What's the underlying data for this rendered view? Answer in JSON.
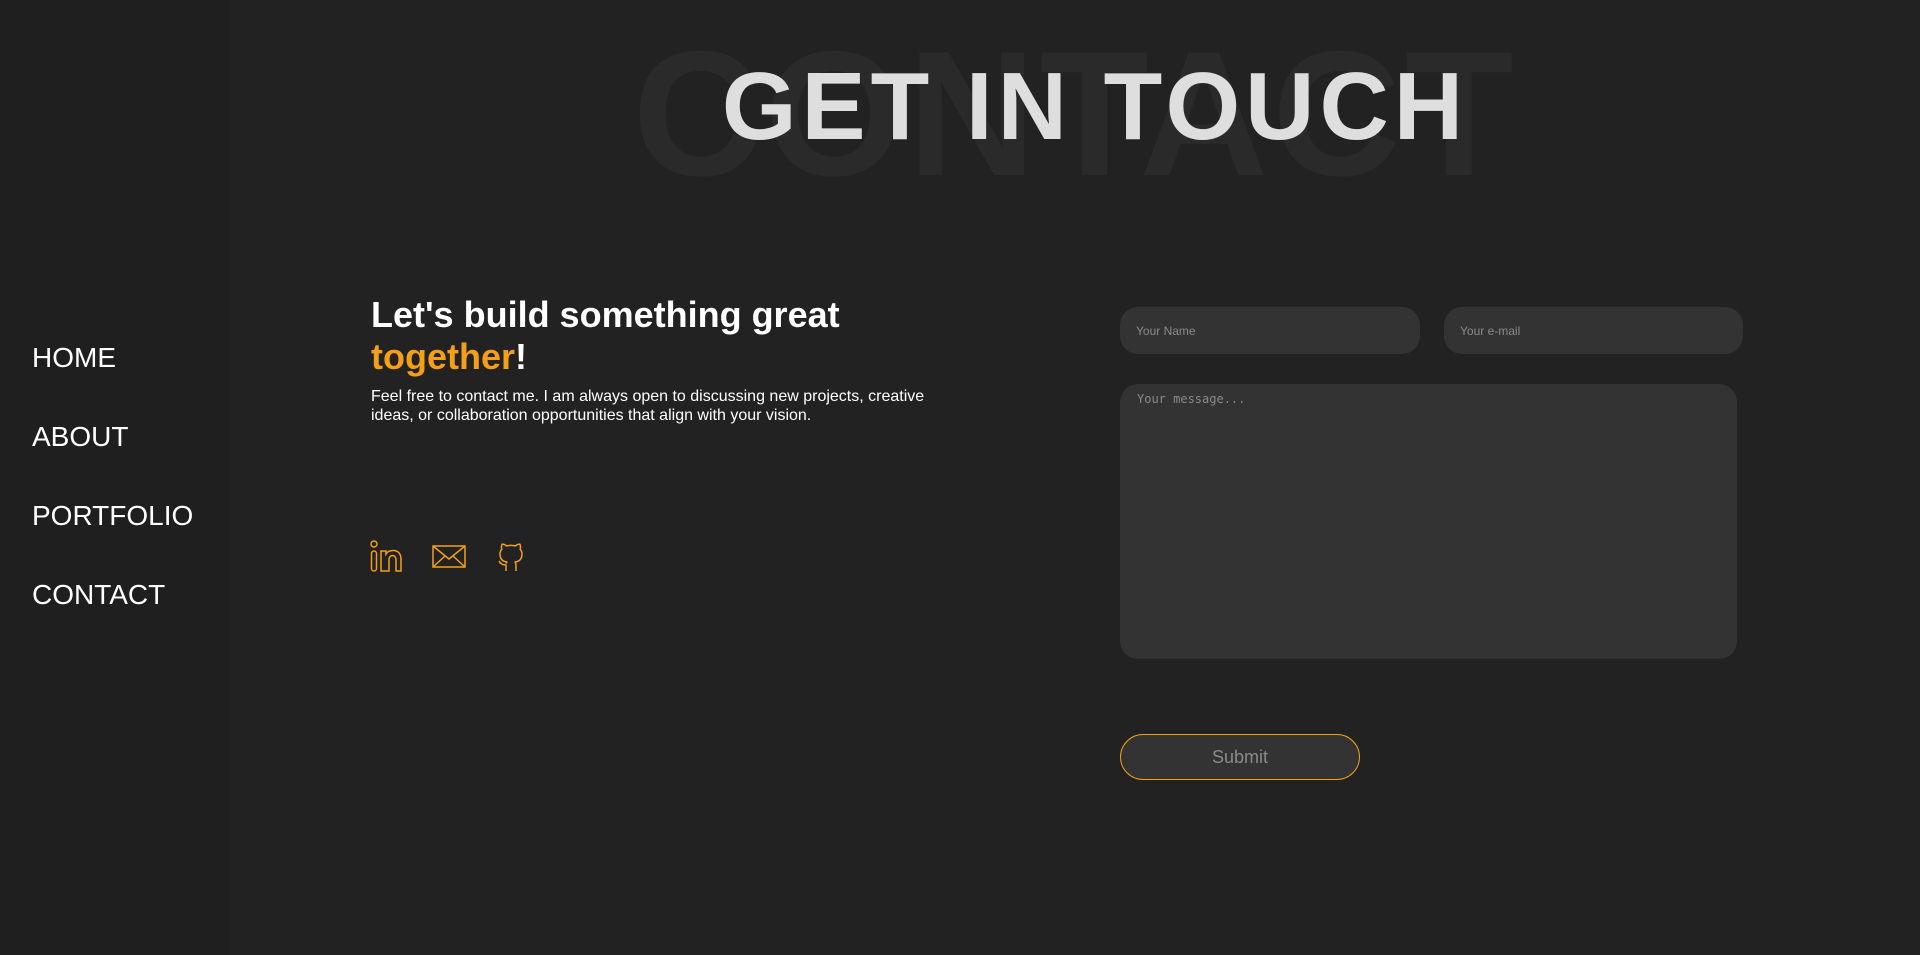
{
  "nav": {
    "items": [
      {
        "label": "HOME"
      },
      {
        "label": "ABOUT"
      },
      {
        "label": "PORTFOLIO"
      },
      {
        "label": "CONTACT"
      }
    ]
  },
  "header": {
    "background_word": "CONTACT",
    "title": "GET IN TOUCH"
  },
  "intro": {
    "title_line1": "Let's build something great",
    "title_accent": "together",
    "title_end": "!",
    "text": "Feel free to contact me. I am always open to discussing new projects, creative ideas, or collaboration opportunities that align with your vision."
  },
  "social": {
    "icons": [
      "linkedin-icon",
      "mail-icon",
      "github-icon"
    ]
  },
  "form": {
    "name_placeholder": "Your Name",
    "email_placeholder": "Your e-mail",
    "message_placeholder": "Your message...",
    "submit_label": "Submit"
  },
  "colors": {
    "background": "#222222",
    "sidebar": "#1f1f1f",
    "accent": "#f59f18",
    "field": "#333333"
  }
}
